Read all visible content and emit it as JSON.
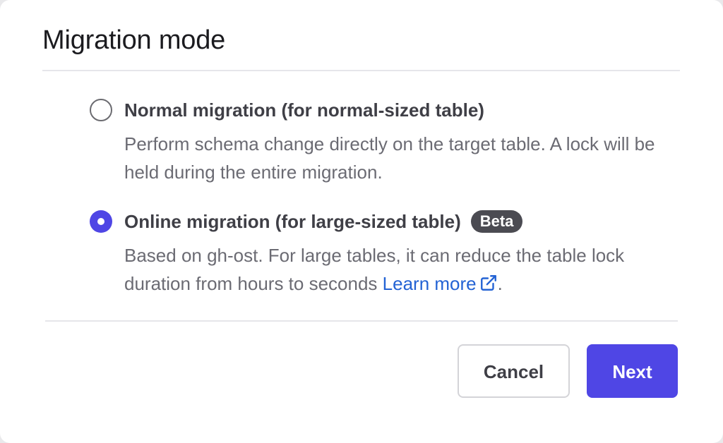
{
  "dialog": {
    "title": "Migration mode"
  },
  "options": [
    {
      "label": "Normal migration (for normal-sized table)",
      "description": "Perform schema change directly on the target table. A lock will be held during the entire migration.",
      "selected": false
    },
    {
      "label": "Online migration (for large-sized table)",
      "badge": "Beta",
      "description_prefix": "Based on gh-ost. For large tables, it can reduce the table lock duration from hours to seconds",
      "link_text": "Learn more",
      "link_icon": "external-link-icon",
      "description_suffix": ".",
      "selected": true
    }
  ],
  "footer": {
    "cancel_label": "Cancel",
    "next_label": "Next"
  },
  "colors": {
    "accent": "#4f46e5",
    "link": "#2463d4",
    "badge_bg": "#4b4b52"
  }
}
